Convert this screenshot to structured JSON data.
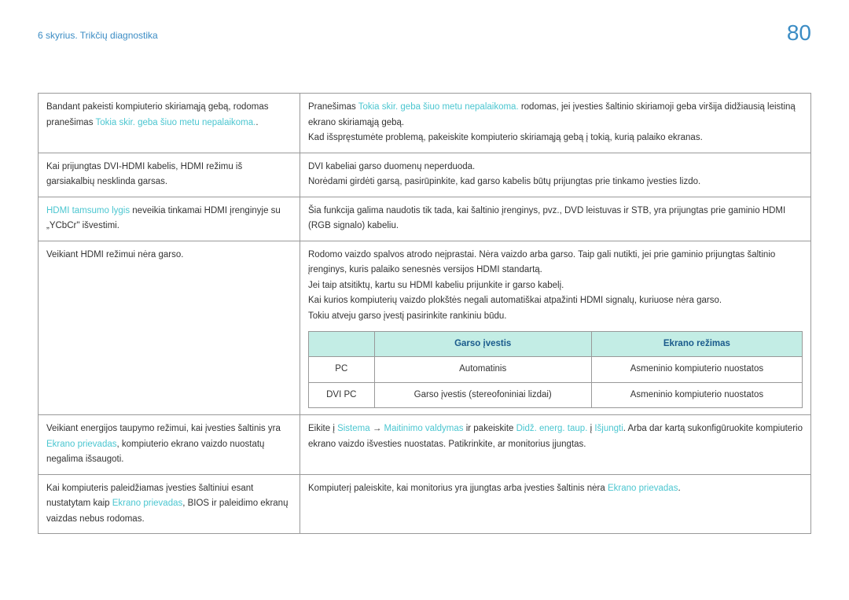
{
  "header": {
    "chapter": "6 skyrius. Trikčių diagnostika",
    "page": "80"
  },
  "rows": [
    {
      "left_p1": "Bandant pakeisti kompiuterio skiriamąją gebą, rodomas pranešimas ",
      "left_link1": "Tokia skir. geba šiuo metu nepalaikoma.",
      "left_p2": ".",
      "right_p1": "Pranešimas ",
      "right_link1": "Tokia skir. geba šiuo metu nepalaikoma.",
      "right_p2": " rodomas, jei įvesties šaltinio skiriamoji geba viršija didžiausią leistiną ekrano skiriamąją gebą.",
      "right_p3": "Kad išspręstumėte problemą, pakeiskite kompiuterio skiriamąją gebą į tokią, kurią palaiko ekranas."
    },
    {
      "left": "Kai prijungtas DVI-HDMI kabelis, HDMI režimu iš garsiakalbių nesklinda garsas.",
      "right_p1": "DVI kabeliai garso duomenų neperduoda.",
      "right_p2": "Norėdami girdėti garsą, pasirūpinkite, kad garso kabelis būtų prijungtas prie tinkamo įvesties lizdo."
    },
    {
      "left_link": "HDMI tamsumo lygis",
      "left_suffix": " neveikia tinkamai HDMI įrenginyje su „YCbCr\" išvestimi.",
      "right": "Šia funkcija galima naudotis tik tada, kai šaltinio įrenginys, pvz., DVD leistuvas ir STB, yra prijungtas prie gaminio HDMI (RGB signalo) kabeliu."
    },
    {
      "left": "Veikiant HDMI režimui nėra garso.",
      "right_p1": "Rodomo vaizdo spalvos atrodo neįprastai. Nėra vaizdo arba garso. Taip gali nutikti, jei prie gaminio prijungtas šaltinio įrenginys, kuris palaiko senesnės versijos HDMI standartą.",
      "right_p2": "Jei taip atsitiktų, kartu su HDMI kabeliu prijunkite ir garso kabelį.",
      "right_p3": "Kai kurios kompiuterių vaizdo plokštės negali automatiškai atpažinti HDMI signalų, kuriuose nėra garso.",
      "right_p4": "Tokiu atveju garso įvestį pasirinkite rankiniu būdu."
    },
    {
      "left_p1": "Veikiant energijos taupymo režimui, kai įvesties šaltinis yra ",
      "left_link": "Ekrano prievadas",
      "left_p2": ", kompiuterio ekrano vaizdo nuostatų negalima išsaugoti.",
      "right_p1a": "Eikite į ",
      "right_link1": "Sistema",
      "right_arrow": " → ",
      "right_link2": "Maitinimo valdymas",
      "right_p1b": " ir pakeiskite ",
      "right_link3": "Didž. energ. taup.",
      "right_p1c": " į ",
      "right_link4": "Išjungti",
      "right_p1d": ". Arba dar kartą sukonfigūruokite kompiuterio ekrano vaizdo išvesties nuostatas. Patikrinkite, ar monitorius įjungtas."
    },
    {
      "left_p1": "Kai kompiuteris paleidžiamas įvesties šaltiniui esant nustatytam kaip ",
      "left_link": "Ekrano prievadas",
      "left_p2": ", BIOS ir paleidimo ekranų vaizdas nebus rodomas.",
      "right_p1": "Kompiuterį paleiskite, kai monitorius yra įjungtas arba įvesties šaltinis nėra ",
      "right_link": "Ekrano prievadas",
      "right_p2": "."
    }
  ],
  "inner_table": {
    "headers": {
      "col1": "",
      "col2": "Garso įvestis",
      "col3": "Ekrano režimas"
    },
    "rows": [
      {
        "c1": "PC",
        "c2": "Automatinis",
        "c3": "Asmeninio kompiuterio nuostatos"
      },
      {
        "c1": "DVI PC",
        "c2": "Garso įvestis (stereofoniniai lizdai)",
        "c3": "Asmeninio kompiuterio nuostatos"
      }
    ]
  }
}
